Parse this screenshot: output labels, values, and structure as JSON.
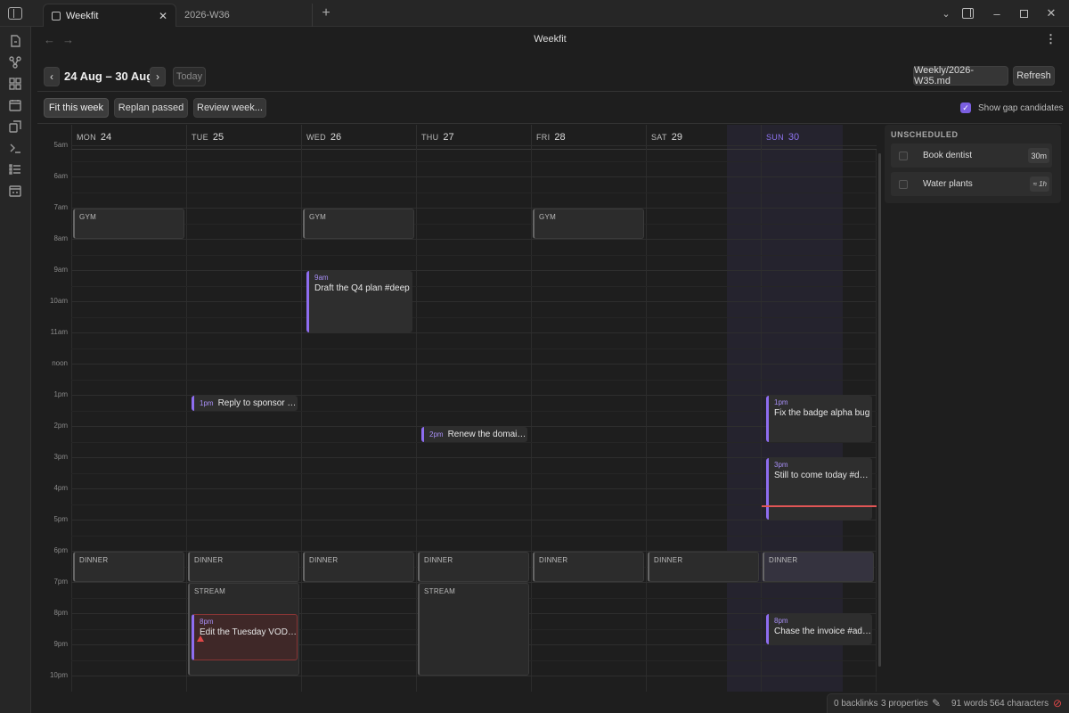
{
  "window": {
    "tabs": [
      {
        "label": "Weekfit",
        "active": true
      },
      {
        "label": "2026-W36",
        "active": false
      }
    ]
  },
  "view": {
    "title": "Weekfit"
  },
  "toolbar": {
    "prev": "‹",
    "next": "›",
    "range": "24 Aug – 30 Aug",
    "today": "Today",
    "file": "Weekly/2026-W35.md",
    "refresh": "Refresh",
    "fit": "Fit this week",
    "replan": "Replan passed",
    "review": "Review week...",
    "gap_label": "Show gap candidates",
    "gap_checked": true
  },
  "days": [
    {
      "name": "MON",
      "date": "24"
    },
    {
      "name": "TUE",
      "date": "25"
    },
    {
      "name": "WED",
      "date": "26"
    },
    {
      "name": "THU",
      "date": "27"
    },
    {
      "name": "FRI",
      "date": "28"
    },
    {
      "name": "SAT",
      "date": "29"
    },
    {
      "name": "SUN",
      "date": "30",
      "today": true
    }
  ],
  "time_labels": [
    "5am",
    "6am",
    "7am",
    "8am",
    "9am",
    "10am",
    "11am",
    "noon",
    "1pm",
    "2pm",
    "3pm",
    "4pm",
    "5pm",
    "6pm",
    "7pm",
    "8pm",
    "9pm",
    "10pm"
  ],
  "blocks": [
    {
      "day": 0,
      "label": "GYM",
      "start": 7,
      "end": 8
    },
    {
      "day": 2,
      "label": "GYM",
      "start": 7,
      "end": 8
    },
    {
      "day": 4,
      "label": "GYM",
      "start": 7,
      "end": 8
    },
    {
      "day": 0,
      "label": "DINNER",
      "start": 18,
      "end": 19
    },
    {
      "day": 1,
      "label": "DINNER",
      "start": 18,
      "end": 19
    },
    {
      "day": 2,
      "label": "DINNER",
      "start": 18,
      "end": 19
    },
    {
      "day": 3,
      "label": "DINNER",
      "start": 18,
      "end": 19
    },
    {
      "day": 4,
      "label": "DINNER",
      "start": 18,
      "end": 19
    },
    {
      "day": 5,
      "label": "DINNER",
      "start": 18,
      "end": 19
    },
    {
      "day": 6,
      "label": "DINNER",
      "start": 18,
      "end": 19
    },
    {
      "day": 1,
      "label": "STREAM",
      "start": 19,
      "end": 22
    },
    {
      "day": 3,
      "label": "STREAM",
      "start": 19,
      "end": 22
    }
  ],
  "events": [
    {
      "day": 2,
      "time": "9am",
      "title": "Draft the Q4 plan #deep",
      "start": 9,
      "end": 11
    },
    {
      "day": 1,
      "time": "1pm",
      "title": "Reply to sponsor e...",
      "start": 13,
      "end": 13.5,
      "inline": true
    },
    {
      "day": 3,
      "time": "2pm",
      "title": "Renew the domain ...",
      "start": 14,
      "end": 14.5,
      "inline": true
    },
    {
      "day": 6,
      "time": "1pm",
      "title": "Fix the badge alpha bug",
      "start": 13,
      "end": 14.5
    },
    {
      "day": 6,
      "time": "3pm",
      "title": "Still to come today #deep",
      "start": 15,
      "end": 17
    },
    {
      "day": 1,
      "time": "8pm",
      "title": "Edit the Tuesday VOD ...",
      "start": 20,
      "end": 21.5,
      "warn": true
    },
    {
      "day": 6,
      "time": "8pm",
      "title": "Chase the invoice #admin",
      "start": 20,
      "end": 21
    }
  ],
  "unscheduled": {
    "title": "UNSCHEDULED",
    "items": [
      {
        "name": "Book dentist",
        "duration": "30m",
        "estimated": false
      },
      {
        "name": "Water plants",
        "duration": "≈ 1h",
        "estimated": true
      }
    ]
  },
  "status": {
    "backlinks": "0 backlinks",
    "properties": "3 properties",
    "words": "91 words",
    "characters": "564 characters"
  }
}
